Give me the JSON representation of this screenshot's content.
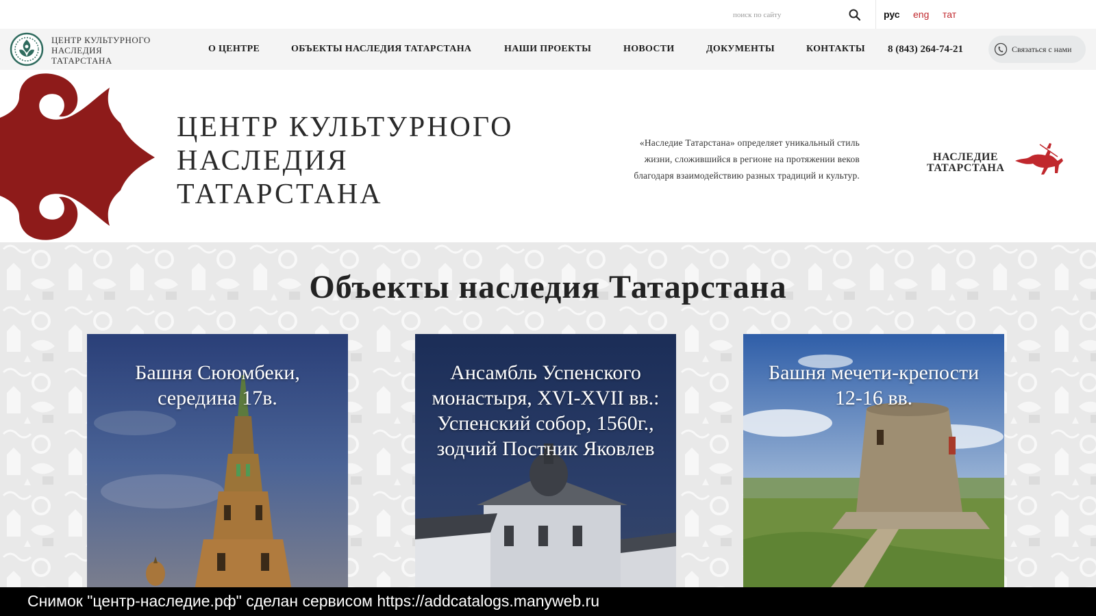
{
  "topbar": {
    "search_placeholder": "поиск по сайту",
    "languages": [
      "рус",
      "eng",
      "тат"
    ]
  },
  "header": {
    "logo_lines": [
      "ЦЕНТР КУЛЬТУРНОГО",
      "НАСЛЕДИЯ",
      "ТАТАРСТАНА"
    ],
    "nav": [
      "О ЦЕНТРЕ",
      "ОБЪЕКТЫ НАСЛЕДИЯ ТАТАРСТАНА",
      "НАШИ ПРОЕКТЫ",
      "НОВОСТИ",
      "ДОКУМЕНТЫ",
      "КОНТАКТЫ"
    ],
    "phone": "8 (843) 264-74-21",
    "contact_label": "Связаться с нами"
  },
  "hero": {
    "title_lines": [
      "ЦЕНТР КУЛЬТУРНОГО",
      "НАСЛЕДИЯ",
      "ТАТАРСТАНА"
    ],
    "description_lines": [
      "«Наследие Татарстана» определяет уникальный стиль",
      "жизни, сложившийся в регионе на протяжении веков",
      "благодаря взаимодействию разных традиций и культур."
    ],
    "brand_lines": [
      "НАСЛЕДИЕ",
      "ТАТАРСТАНА"
    ]
  },
  "objects": {
    "title": "Объекты наследия Татарстана",
    "cards": [
      {
        "caption": "Башня Сююмбеки, середина 17в."
      },
      {
        "caption": "Ансамбль Успенского монастыря, XVI-XVII вв.: Успенский собор, 1560г., зодчий Постник Яковлев"
      },
      {
        "caption": "Башня мечети-крепости 12-16 вв."
      }
    ]
  },
  "screenshot_note": "Снимок \"центр-наследие.рф\" сделан сервисом https://addcatalogs.manyweb.ru",
  "colors": {
    "accent_red": "#8e1b1a",
    "lang_red": "#c0282d",
    "nav_bg": "#f4f4f4",
    "section_bg": "#ececec"
  }
}
